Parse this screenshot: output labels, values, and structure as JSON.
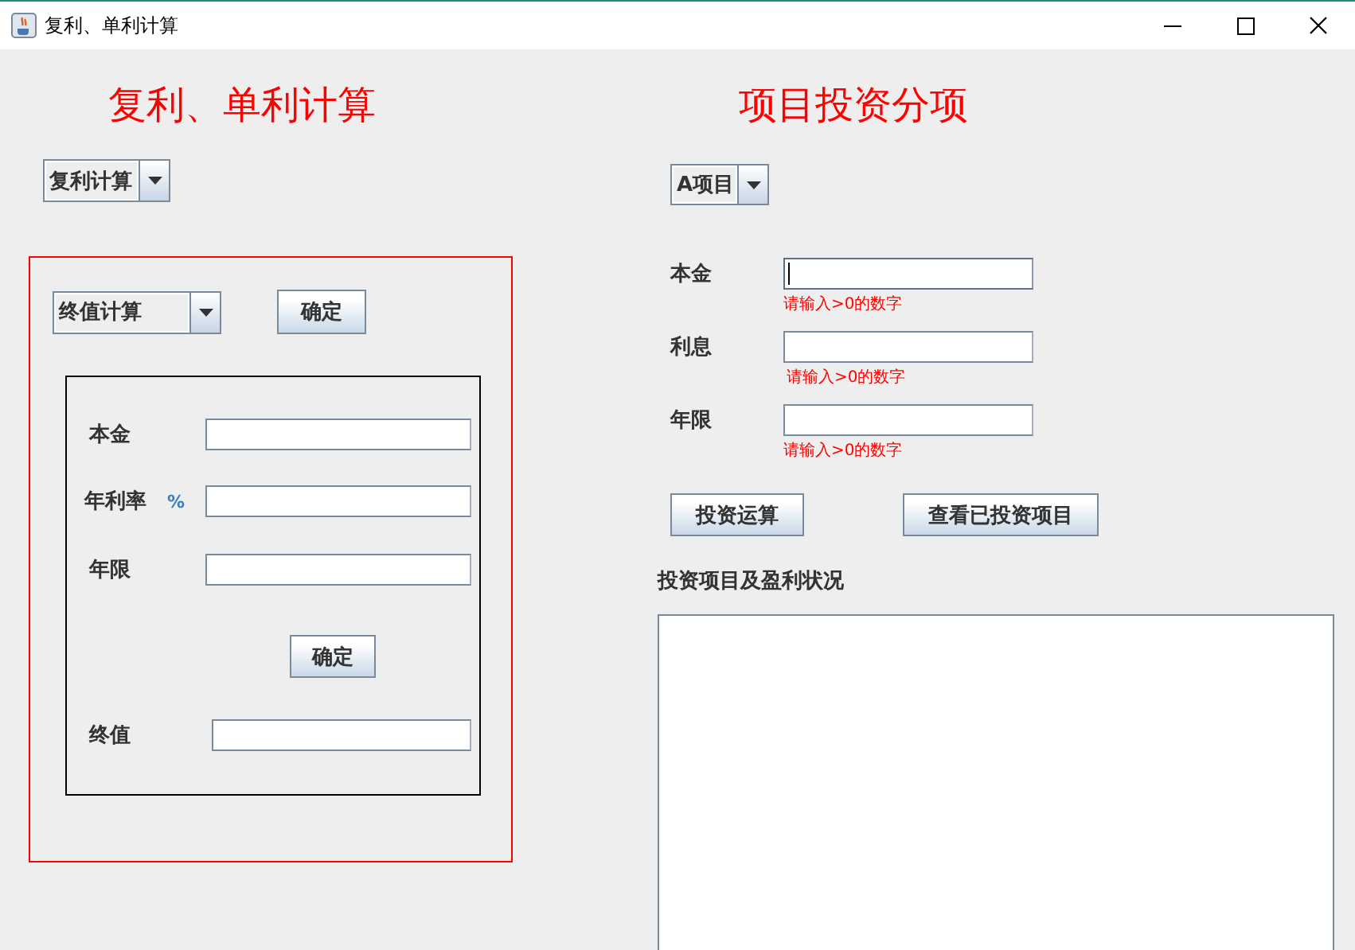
{
  "window": {
    "title": "复利、单利计算"
  },
  "left": {
    "heading": "复利、单利计算",
    "mode_select": {
      "value": "复利计算"
    },
    "panel": {
      "calc_select": {
        "value": "终值计算"
      },
      "confirm_button": "确定",
      "fields": [
        {
          "label": "本金"
        },
        {
          "label": "年利率",
          "unit": "%"
        },
        {
          "label": "年限"
        }
      ],
      "compute_button": "确定",
      "result": {
        "label": "终值"
      }
    }
  },
  "right": {
    "heading": "项目投资分项",
    "project_select": {
      "value": "A项目"
    },
    "fields": [
      {
        "label": "本金",
        "hint": "请输入>0的数字",
        "focused": true
      },
      {
        "label": "利息",
        "hint": "请输入>0的数字",
        "focused": false
      },
      {
        "label": "年限",
        "hint": "请输入>0的数字",
        "focused": false
      }
    ],
    "buttons": [
      "投资运算",
      "查看已投资项目"
    ],
    "output_label": "投资项目及盈利状况"
  }
}
